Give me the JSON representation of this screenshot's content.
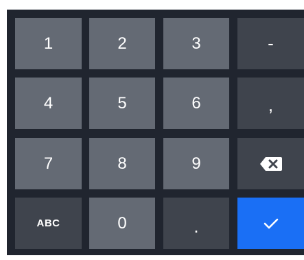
{
  "keypad": {
    "keys": {
      "k1": "1",
      "k2": "2",
      "k3": "3",
      "minus": "-",
      "k4": "4",
      "k5": "5",
      "k6": "6",
      "comma": ",",
      "k7": "7",
      "k8": "8",
      "k9": "9",
      "abc": "ABC",
      "k0": "0",
      "dot": "."
    },
    "icons": {
      "backspace": "backspace-icon",
      "enter": "checkmark-icon"
    },
    "colors": {
      "background": "#20252f",
      "number_key": "#646a74",
      "function_key": "#3f444d",
      "enter_key": "#1a6ff5",
      "text": "#ffffff"
    }
  }
}
